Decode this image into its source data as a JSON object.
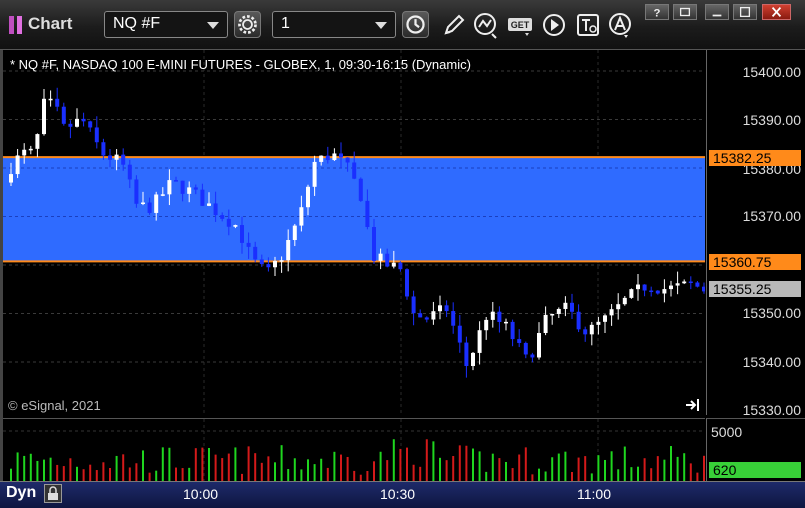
{
  "toolbar": {
    "title": "Chart",
    "symbol_value": "NQ #F",
    "interval_value": "1"
  },
  "chart": {
    "title": "* NQ #F, NASDAQ 100 E-MINI FUTURES - GLOBEX, 1, 09:30-16:15 (Dynamic)",
    "copyright": "© eSignal, 2021",
    "mode_label": "Dyn",
    "price_ticks": [
      "15400.00",
      "15390.00",
      "15380.00",
      "15370.00",
      "15350.00",
      "15340.00",
      "15330.00"
    ],
    "upper_line_label": "15382.25",
    "lower_line_label": "15360.75",
    "last_price_label": "15355.25",
    "volume_ticks": [
      "5000"
    ],
    "last_volume_label": "620",
    "time_labels": [
      "10:00",
      "10:30",
      "11:00"
    ],
    "colors": {
      "zone": "#2f6bff",
      "zone_line": "#ff8a1a",
      "up_candle": "#ffffff",
      "down_candle": "#1a2fff",
      "volume_up": "#1fd61f",
      "volume_down": "#d41a1a",
      "last_price_flag": "#b9b9b9",
      "volume_flag": "#38d038"
    }
  }
}
